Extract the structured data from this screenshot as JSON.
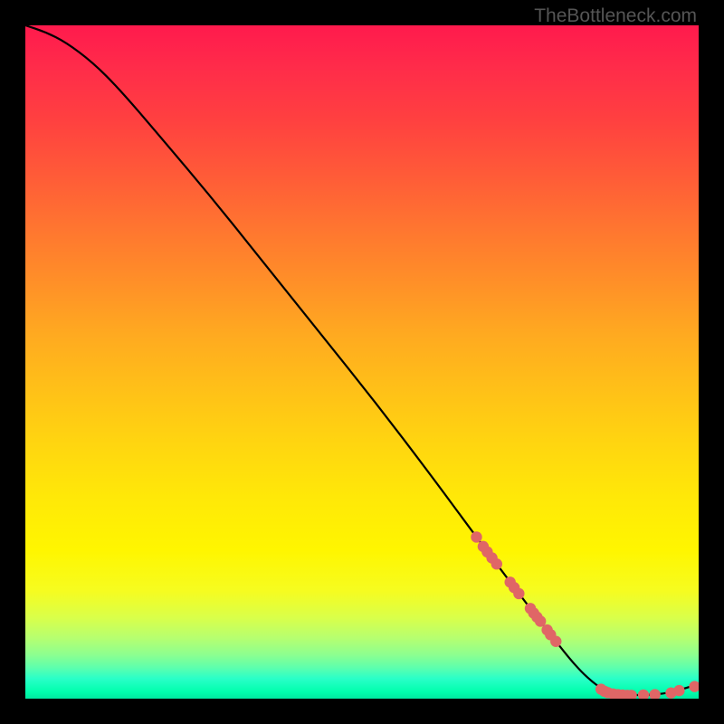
{
  "watermark": "TheBottleneck.com",
  "chart_data": {
    "type": "line",
    "title": "",
    "xlabel": "",
    "ylabel": "",
    "xlim": [
      0,
      100
    ],
    "ylim": [
      0,
      100
    ],
    "curve": {
      "color": "#000000",
      "points": [
        {
          "x": 0,
          "y": 100
        },
        {
          "x": 3,
          "y": 99
        },
        {
          "x": 6,
          "y": 97.5
        },
        {
          "x": 10,
          "y": 94.5
        },
        {
          "x": 14,
          "y": 90.5
        },
        {
          "x": 20,
          "y": 83.5
        },
        {
          "x": 28,
          "y": 74
        },
        {
          "x": 36,
          "y": 64
        },
        {
          "x": 44,
          "y": 54
        },
        {
          "x": 52,
          "y": 44
        },
        {
          "x": 60,
          "y": 33.5
        },
        {
          "x": 67,
          "y": 24
        },
        {
          "x": 73,
          "y": 16
        },
        {
          "x": 78,
          "y": 9.5
        },
        {
          "x": 82,
          "y": 4.5
        },
        {
          "x": 85,
          "y": 1.8
        },
        {
          "x": 87,
          "y": 0.8
        },
        {
          "x": 90,
          "y": 0.5
        },
        {
          "x": 94,
          "y": 0.6
        },
        {
          "x": 97,
          "y": 1.2
        },
        {
          "x": 100,
          "y": 2.2
        }
      ]
    },
    "scatter": {
      "color": "#e06666",
      "points": [
        {
          "x": 67,
          "y": 24
        },
        {
          "x": 68,
          "y": 22.6
        },
        {
          "x": 68.6,
          "y": 21.8
        },
        {
          "x": 69.3,
          "y": 20.9
        },
        {
          "x": 70,
          "y": 20
        },
        {
          "x": 72,
          "y": 17.3
        },
        {
          "x": 72.6,
          "y": 16.5
        },
        {
          "x": 73.3,
          "y": 15.6
        },
        {
          "x": 75,
          "y": 13.4
        },
        {
          "x": 75.5,
          "y": 12.7
        },
        {
          "x": 76,
          "y": 12.1
        },
        {
          "x": 76.5,
          "y": 11.5
        },
        {
          "x": 77.5,
          "y": 10.2
        },
        {
          "x": 78,
          "y": 9.5
        },
        {
          "x": 78.8,
          "y": 8.5
        },
        {
          "x": 85.5,
          "y": 1.4
        },
        {
          "x": 86,
          "y": 1.1
        },
        {
          "x": 86.5,
          "y": 0.9
        },
        {
          "x": 87.3,
          "y": 0.7
        },
        {
          "x": 88,
          "y": 0.6
        },
        {
          "x": 88.7,
          "y": 0.55
        },
        {
          "x": 89.4,
          "y": 0.5
        },
        {
          "x": 90,
          "y": 0.5
        },
        {
          "x": 91.8,
          "y": 0.55
        },
        {
          "x": 93.5,
          "y": 0.6
        },
        {
          "x": 95.9,
          "y": 0.85
        },
        {
          "x": 97.1,
          "y": 1.2
        },
        {
          "x": 99.4,
          "y": 1.8
        }
      ]
    }
  }
}
